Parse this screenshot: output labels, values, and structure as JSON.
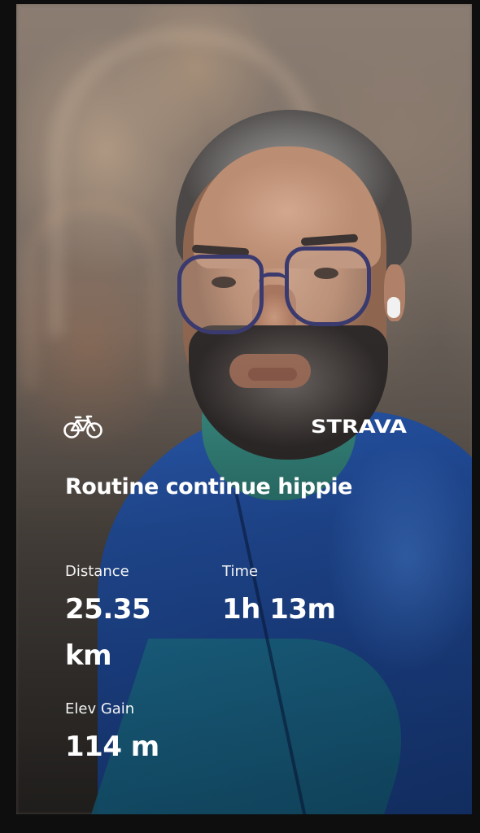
{
  "activity": {
    "sport_icon": "bicycle-icon",
    "brand": "STRAVA",
    "title": "Routine continue hippie",
    "accent_color": "#ffffff"
  },
  "stats": [
    {
      "label": "Distance",
      "value": "25.35 km"
    },
    {
      "label": "Time",
      "value": "1h 13m"
    },
    {
      "label": "Elev Gain",
      "value": "114 m"
    }
  ]
}
